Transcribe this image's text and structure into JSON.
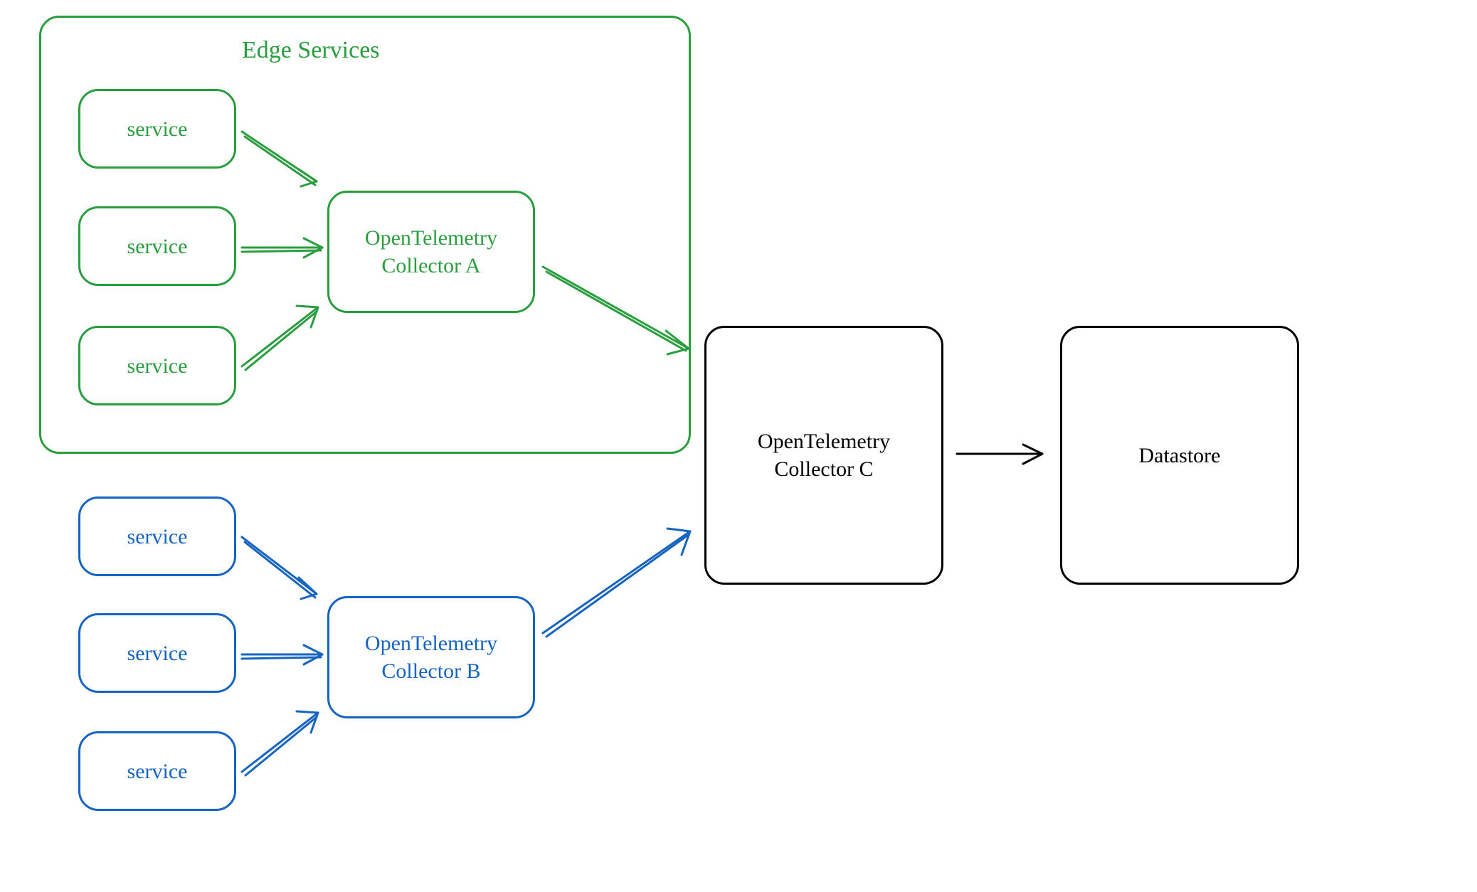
{
  "container": {
    "title": "Edge Services"
  },
  "green": {
    "service1": "service",
    "service2": "service",
    "service3": "service",
    "collector": "OpenTelemetry\nCollector A"
  },
  "blue": {
    "service1": "service",
    "service2": "service",
    "service3": "service",
    "collector": "OpenTelemetry\nCollector B"
  },
  "collectorC": "OpenTelemetry\nCollector C",
  "datastore": "Datastore",
  "colors": {
    "green": "#2a9d3f",
    "blue": "#1565c0",
    "black": "#000000"
  }
}
